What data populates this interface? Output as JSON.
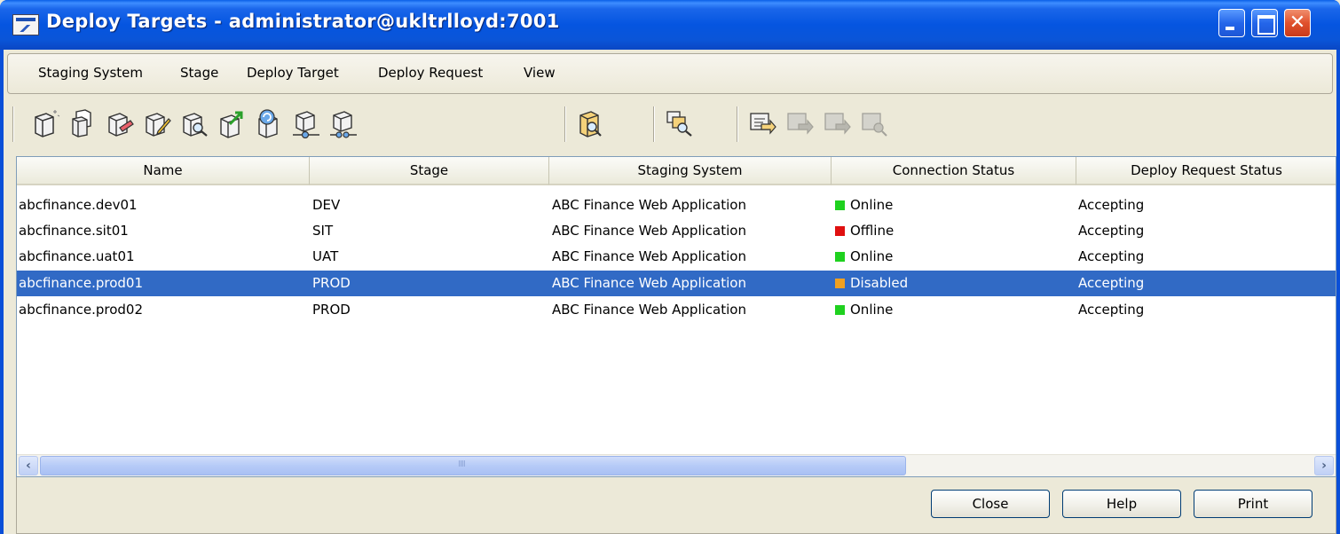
{
  "window": {
    "title": "Deploy Targets - administrator@ukltrlloyd:7001"
  },
  "menu": {
    "items": [
      "Staging System",
      "Stage",
      "Deploy Target",
      "Deploy Request",
      "View"
    ]
  },
  "toolbar": {
    "icons": [
      "new-target-icon",
      "copy-target-icon",
      "delete-target-icon",
      "edit-target-icon",
      "find-target-icon",
      "export-target-icon",
      "refresh-target-icon",
      "connect-target-icon",
      "disconnect-target-icon",
      "search-folder-icon",
      "find-staging-icon",
      "deploy-request-icon",
      "deploy-request-disabled-icon",
      "deploy-request-disabled-icon",
      "deploy-request-disabled-icon"
    ]
  },
  "table": {
    "columns": [
      "Name",
      "Stage",
      "Staging System",
      "Connection Status",
      "Deploy Request Status"
    ],
    "rows": [
      {
        "name": "abcfinance.dev01",
        "stage": "DEV",
        "staging_system": "ABC Finance Web Application",
        "connection_status": "Online",
        "status_color": "#1fd11f",
        "deploy_request_status": "Accepting",
        "selected": false
      },
      {
        "name": "abcfinance.sit01",
        "stage": "SIT",
        "staging_system": "ABC Finance Web Application",
        "connection_status": "Offline",
        "status_color": "#e01010",
        "deploy_request_status": "Accepting",
        "selected": false
      },
      {
        "name": "abcfinance.uat01",
        "stage": "UAT",
        "staging_system": "ABC Finance Web Application",
        "connection_status": "Online",
        "status_color": "#1fd11f",
        "deploy_request_status": "Accepting",
        "selected": false
      },
      {
        "name": "abcfinance.prod01",
        "stage": "PROD",
        "staging_system": "ABC Finance Web Application",
        "connection_status": "Disabled",
        "status_color": "#f0a020",
        "deploy_request_status": "Accepting",
        "selected": true
      },
      {
        "name": "abcfinance.prod02",
        "stage": "PROD",
        "staging_system": "ABC Finance Web Application",
        "connection_status": "Online",
        "status_color": "#1fd11f",
        "deploy_request_status": "Accepting",
        "selected": false
      }
    ]
  },
  "buttons": {
    "close": "Close",
    "help": "Help",
    "print": "Print"
  },
  "colors": {
    "selection": "#316ac5",
    "titlebar": "#0a55d8"
  }
}
